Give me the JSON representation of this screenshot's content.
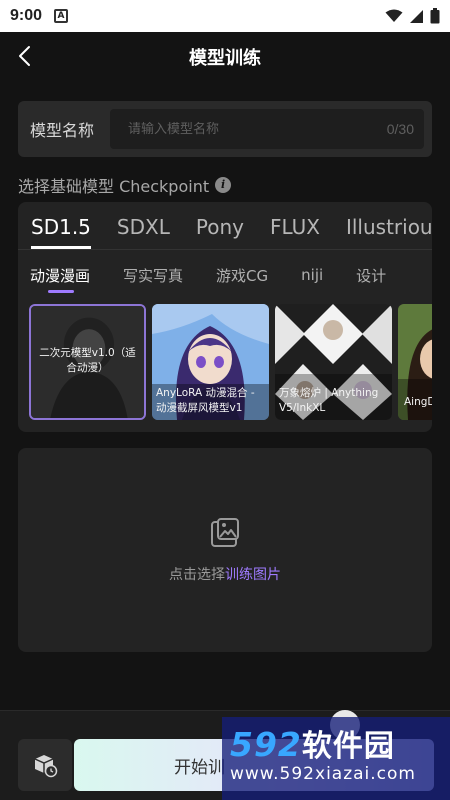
{
  "status_bar": {
    "time": "9:00",
    "notification_badge": "A"
  },
  "header": {
    "title": "模型训练"
  },
  "name_field": {
    "label": "模型名称",
    "placeholder": "请输入模型名称",
    "value": "",
    "counter": "0/30"
  },
  "base_model_section": {
    "title": "选择基础模型 Checkpoint",
    "base_tabs": [
      {
        "label": "SD1.5",
        "active": true
      },
      {
        "label": "SDXL",
        "active": false
      },
      {
        "label": "Pony",
        "active": false
      },
      {
        "label": "FLUX",
        "active": false
      },
      {
        "label": "Illustrious",
        "active": false
      }
    ],
    "style_tabs": [
      {
        "label": "动漫漫画",
        "active": true
      },
      {
        "label": "写实写真",
        "active": false
      },
      {
        "label": "游戏CG",
        "active": false
      },
      {
        "label": "niji",
        "active": false
      },
      {
        "label": "设计",
        "active": false
      }
    ],
    "models": [
      {
        "label": "二次元模型v1.0（适合动漫）",
        "selected": true
      },
      {
        "label": "AnyLoRA 动漫混合 - 动漫截屏风模型v1",
        "selected": false
      },
      {
        "label": "万象熔炉 | Anything V5/InkXL",
        "selected": false
      },
      {
        "label": "AingD",
        "selected": false
      }
    ]
  },
  "upload": {
    "text_prefix": "点击选择",
    "text_accent": "训练图片"
  },
  "bottom": {
    "start_label": "开始训"
  },
  "watermark": {
    "digits": "592",
    "brand": "软件园",
    "url": "www.592xiazai.com"
  },
  "colors": {
    "accent": "#9f7bff",
    "background": "#131313",
    "panel": "#232323"
  }
}
